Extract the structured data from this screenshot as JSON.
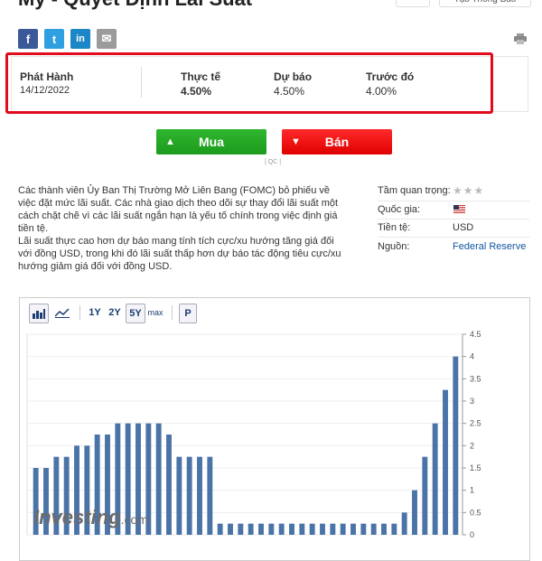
{
  "title": "Mỹ - Quyết Định Lãi Suất",
  "header_button_2": "Tạo Thông Báo",
  "social": {
    "facebook": "f",
    "twitter": "t",
    "linkedin": "in",
    "email": "✉"
  },
  "event": {
    "release_label": "Phát Hành",
    "release_date": "14/12/2022",
    "actual_label": "Thực tế",
    "actual_value": "4.50%",
    "forecast_label": "Dự báo",
    "forecast_value": "4.50%",
    "previous_label": "Trước đó",
    "previous_value": "4.00%"
  },
  "buttons": {
    "buy": "Mua",
    "sell": "Bán",
    "ad": "| QC |"
  },
  "description": {
    "p1": "Các thành viên Ủy Ban Thị Trường Mở Liên Bang (FOMC) bỏ phiếu về việc đặt mức lãi suất. Các nhà giao dịch theo dõi sự thay đổi lãi suất một cách chặt chẽ vì các lãi suất ngắn hạn là yếu tố chính trong việc định giá tiền tệ.",
    "p2": "Lãi suất thực cao hơn dự báo mang tính tích cực/xu hướng tăng giá đối với đồng USD, trong khi đó lãi suất thấp hơn dự báo tác động tiêu cực/xu hướng giảm giá đối với đồng USD."
  },
  "meta": {
    "importance_label": "Tầm quan trọng:",
    "country_label": "Quốc gia:",
    "currency_label": "Tiền tệ:",
    "currency_value": "USD",
    "source_label": "Nguồn:",
    "source_value": "Federal Reserve"
  },
  "chart_toolbar": {
    "r1": "1Y",
    "r2": "2Y",
    "r5": "5Y",
    "rmax": "max",
    "p": "P"
  },
  "watermark": {
    "brand": "Investing",
    "suffix": ".com"
  },
  "chart_data": {
    "type": "bar",
    "ylim": [
      0,
      4.5
    ],
    "yticks": [
      "0",
      "0.5",
      "1",
      "1.5",
      "2",
      "2.5",
      "3",
      "3.5",
      "4",
      "4.5"
    ],
    "values": [
      1.5,
      1.5,
      1.75,
      1.75,
      2.0,
      2.0,
      2.25,
      2.25,
      2.5,
      2.5,
      2.5,
      2.5,
      2.5,
      2.25,
      1.75,
      1.75,
      1.75,
      1.75,
      0.25,
      0.25,
      0.25,
      0.25,
      0.25,
      0.25,
      0.25,
      0.25,
      0.25,
      0.25,
      0.25,
      0.25,
      0.25,
      0.25,
      0.25,
      0.25,
      0.25,
      0.25,
      0.5,
      1.0,
      1.75,
      2.5,
      3.25,
      4.0
    ],
    "bar_color": "#4a73a8",
    "grid": true
  }
}
